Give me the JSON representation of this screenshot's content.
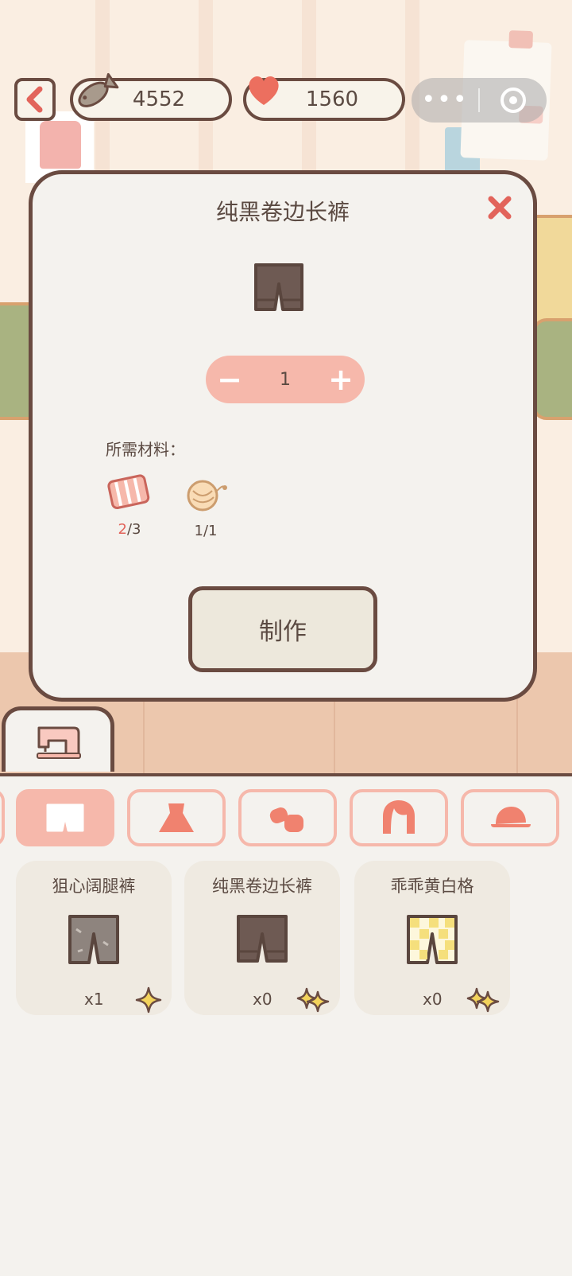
{
  "currency": {
    "fish": "4552",
    "heart": "1560"
  },
  "modal": {
    "title": "纯黑卷边长裤",
    "quantity": "1",
    "materials_label": "所需材料：",
    "materials": [
      {
        "name": "pink-fabric",
        "have": "2",
        "need": "/3",
        "sufficient": false
      },
      {
        "name": "yarn-ball",
        "have": "1",
        "need": "/1",
        "sufficient": true
      }
    ],
    "make_label": "制作"
  },
  "categories": [
    "shorts",
    "dress",
    "mittens",
    "hair",
    "cap"
  ],
  "active_category": 0,
  "items": [
    {
      "name": "狙心阔腿裤",
      "count": "x1",
      "stars": 1
    },
    {
      "name": "纯黑卷边长裤",
      "count": "x0",
      "stars": 2
    },
    {
      "name": "乖乖黄白格",
      "count": "x0",
      "stars": 2
    }
  ],
  "colors": {
    "outline": "#6a4b41",
    "accent_pink": "#f6b8ab",
    "close_red": "#e2645b",
    "panel_bg": "#f4f2ee"
  }
}
